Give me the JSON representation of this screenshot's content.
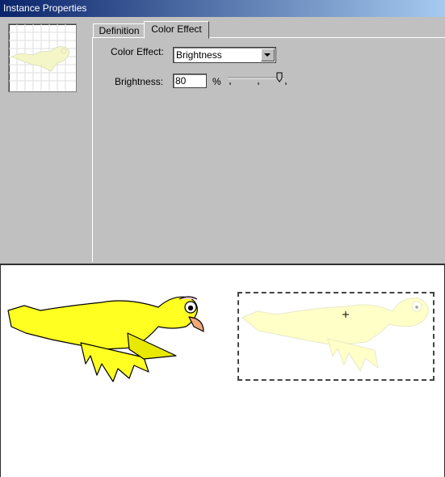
{
  "window": {
    "title": "Instance Properties"
  },
  "tabs": [
    {
      "label": "Definition",
      "active": false
    },
    {
      "label": "Color Effect",
      "active": true
    }
  ],
  "color_effect": {
    "label": "Color Effect:",
    "selected": "Brightness"
  },
  "brightness": {
    "label": "Brightness:",
    "value": "80",
    "unit": "%",
    "slider_fraction": 0.8
  },
  "colors": {
    "bird_body": "#ffff22",
    "bird_faded": "#ffffc8",
    "beak": "#f0a878"
  }
}
